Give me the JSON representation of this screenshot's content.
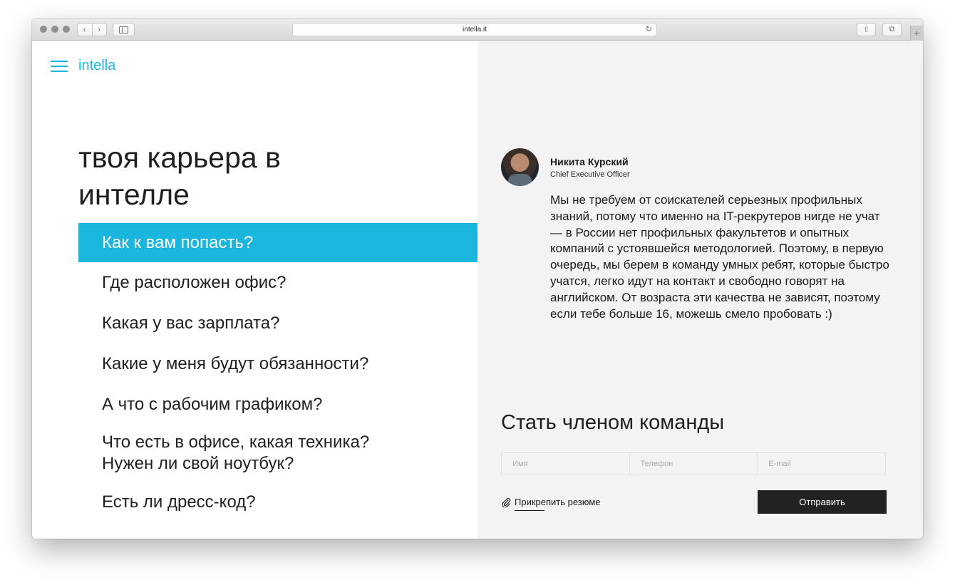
{
  "browser": {
    "url": "intella.it",
    "back_icon": "‹",
    "forward_icon": "›",
    "reload_icon": "↻",
    "share_icon": "⇧",
    "tabs_icon": "⧉",
    "new_tab_icon": "+"
  },
  "header": {
    "logo": "intella"
  },
  "hero": {
    "title": "твоя карьера в интелле"
  },
  "faq": {
    "items": [
      {
        "label": "Как к вам попасть?"
      },
      {
        "label": "Где расположен офис?"
      },
      {
        "label": "Какая у вас зарплата?"
      },
      {
        "label": "Какие у меня будут обязанности?"
      },
      {
        "label": "А что с рабочим графиком?"
      },
      {
        "label": "Что есть в офисе, какая техника?",
        "label2": "Нужен ли свой ноутбук?"
      },
      {
        "label": "Есть ли дресс-код?"
      }
    ]
  },
  "answer": {
    "name": "Никита Курский",
    "role": "Chief Executive Officer",
    "text": "Мы не требуем от соискателей серьезных профильных знаний, потому что именно на IT-рекрутеров нигде не учат — в России нет профильных факультетов и опытных компаний с устоявшейся методологией. Поэтому, в первую очередь, мы берем в команду умных ребят, которые быстро учатся, легко идут на контакт и свободно говорят на английском. От возраста эти качества не зависят, поэтому если тебе больше 16, можешь смело пробовать :)"
  },
  "form": {
    "title": "Стать членом команды",
    "name_placeholder": "Имя",
    "phone_placeholder": "Телефон",
    "email_placeholder": "E-mail",
    "attach_label": "Прикрепить резюме",
    "submit_label": "Отправить"
  },
  "colors": {
    "accent": "#1bb6de",
    "button": "#222222",
    "right_panel": "#f3f3f3"
  }
}
